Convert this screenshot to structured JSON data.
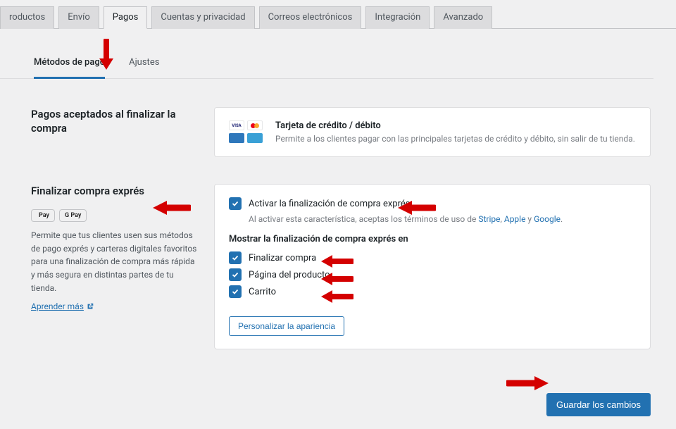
{
  "top_tabs": {
    "productos": "roductos",
    "envio": "Envío",
    "pagos": "Pagos",
    "cuentas": "Cuentas y privacidad",
    "correos": "Correos electrónicos",
    "integracion": "Integración",
    "avanzado": "Avanzado"
  },
  "sub_tabs": {
    "metodos": "Métodos de pago",
    "ajustes": "Ajustes"
  },
  "accepted": {
    "title": "Pagos aceptados al finalizar la compra",
    "card_title": "Tarjeta de crédito / débito",
    "card_desc": "Permite a los clientes pagar con las principales tarjetas de crédito y débito, sin salir de tu tienda.",
    "brands": {
      "visa": "VISA",
      "amex": "AMEX",
      "cb": "CB"
    }
  },
  "express": {
    "title": "Finalizar compra exprés",
    "wallets": {
      "apple": "Pay",
      "google": "G Pay"
    },
    "desc": "Permite que tus clientes usen sus métodos de pago exprés y carteras digitales favoritos para una finalización de compra más rápida y más segura en distintas partes de tu tienda.",
    "learn_more": "Aprender más",
    "enable_label": "Activar la finalización de compra exprés",
    "terms_pre": "Al activar esta característica, aceptas los términos de uso de ",
    "terms_stripe": "Stripe",
    "terms_sep1": ", ",
    "terms_apple": "Apple",
    "terms_sep2": " y ",
    "terms_google": "Google",
    "terms_end": ".",
    "show_heading": "Mostrar la finalización de compra exprés en",
    "loc_checkout": "Finalizar compra",
    "loc_product": "Página del producto",
    "loc_cart": "Carrito",
    "customize": "Personalizar la apariencia"
  },
  "save_button": "Guardar los cambios"
}
